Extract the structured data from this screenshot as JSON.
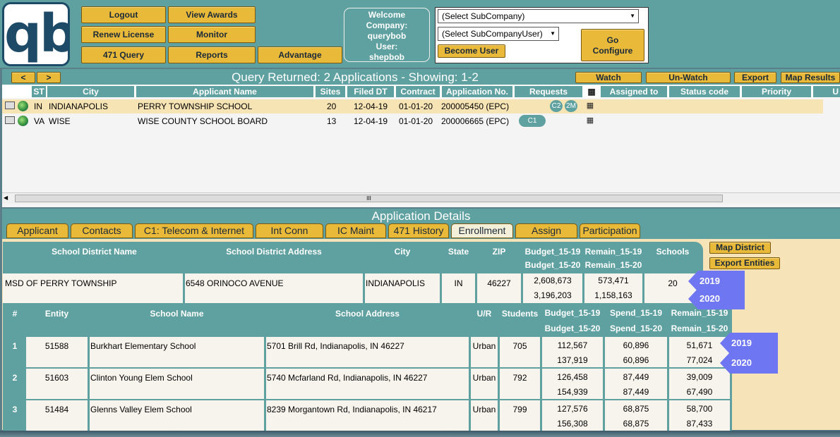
{
  "logo": "qb",
  "nav": {
    "logout": "Logout",
    "view_awards": "View Awards",
    "renew_license": "Renew License",
    "monitor": "Monitor",
    "query_471": "471 Query",
    "reports": "Reports",
    "advantage": "Advantage"
  },
  "welcome": {
    "line1": "Welcome",
    "line2": "Company:",
    "company": "querybob",
    "line4": "User:",
    "user": "shepbob"
  },
  "subcompany": {
    "select_subcompany": "(Select SubCompany)",
    "select_subcompany_user": "(Select SubCompanyUser)",
    "become_user": "Become User",
    "go_configure_1": "Go",
    "go_configure_2": "Configure"
  },
  "query": {
    "prev": "<",
    "next": ">",
    "title": "Query Returned: 2 Applications - Showing: 1-2",
    "watch": "Watch",
    "unwatch": "Un-Watch",
    "export": "Export",
    "map_results": "Map Results",
    "columns": [
      "ST",
      "City",
      "Applicant Name",
      "Sites",
      "Filed DT",
      "Contract",
      "Application No.",
      "Requests",
      "Assigned to",
      "Status code",
      "Priority",
      "U"
    ],
    "rows": [
      {
        "st": "IN",
        "city": "INDIANAPOLIS",
        "name": "PERRY TOWNSHIP SCHOOL",
        "sites": "20",
        "filed": "12-04-19",
        "contract": "01-01-20",
        "app_no": "200005450 (EPC)",
        "req1": "C2",
        "req2": "2M"
      },
      {
        "st": "VA",
        "city": "WISE",
        "name": "WISE COUNTY SCHOOL BOARD",
        "sites": "13",
        "filed": "12-04-19",
        "contract": "01-01-20",
        "app_no": "200006665 (EPC)",
        "req1": "C1"
      }
    ],
    "scroll_grip": "III"
  },
  "details": {
    "title": "Application Details",
    "tabs": [
      "Applicant",
      "Contacts",
      "C1: Telecom & Internet",
      "Int Conn",
      "IC Maint",
      "471 History",
      "Enrollment",
      "Assign",
      "Participation"
    ],
    "active_tab": "Enrollment",
    "map_district": "Map District",
    "export_entities": "Export Entities",
    "district_headers": {
      "name": "School District Name",
      "address": "School District Address",
      "city": "City",
      "state": "State",
      "zip": "ZIP",
      "budget_a": "Budget_15-19",
      "budget_b": "Budget_15-20",
      "remain_a": "Remain_15-19",
      "remain_b": "Remain_15-20",
      "schools": "Schools"
    },
    "district": {
      "name": "MSD OF PERRY TOWNSHIP",
      "address": "6548 ORINOCO AVENUE",
      "city": "INDIANAPOLIS",
      "state": "IN",
      "zip": "46227",
      "budget_a": "2,608,673",
      "budget_b": "3,196,203",
      "remain_a": "573,471",
      "remain_b": "1,158,163",
      "schools": "20"
    },
    "entity_headers": {
      "num": "#",
      "entity": "Entity",
      "school": "School Name",
      "address": "School Address",
      "ur": "U/R",
      "students": "Students",
      "budget_a": "Budget_15-19",
      "budget_b": "Budget_15-20",
      "spend_a": "Spend_15-19",
      "spend_b": "Spend_15-20",
      "remain_a": "Remain_15-19",
      "remain_b": "Remain_15-20"
    },
    "entities": [
      {
        "num": "1",
        "entity": "51588",
        "school": "Burkhart Elementary School",
        "address": "5701 Brill Rd, Indianapolis, IN 46227",
        "ur": "Urban",
        "students": "705",
        "budget_a": "112,567",
        "budget_b": "137,919",
        "spend_a": "60,896",
        "spend_b": "60,896",
        "remain_a": "51,671",
        "remain_b": "77,024"
      },
      {
        "num": "2",
        "entity": "51603",
        "school": "Clinton Young Elem School",
        "address": "5740 Mcfarland Rd, Indianapolis, IN 46227",
        "ur": "Urban",
        "students": "792",
        "budget_a": "126,458",
        "budget_b": "154,939",
        "spend_a": "87,449",
        "spend_b": "87,449",
        "remain_a": "39,009",
        "remain_b": "67,490"
      },
      {
        "num": "3",
        "entity": "51484",
        "school": "Glenns Valley Elem School",
        "address": "8239 Morgantown Rd, Indianapolis, IN 46217",
        "ur": "Urban",
        "students": "799",
        "budget_a": "127,576",
        "budget_b": "156,308",
        "spend_a": "68,875",
        "spend_b": "68,875",
        "remain_a": "58,700",
        "remain_b": "87,433"
      }
    ],
    "callouts": [
      "2019",
      "2020",
      "2019",
      "2020"
    ]
  }
}
